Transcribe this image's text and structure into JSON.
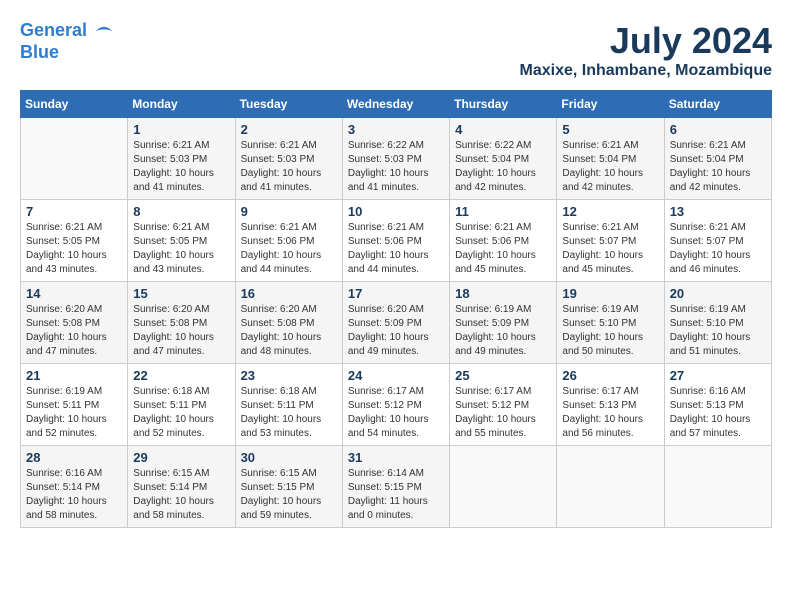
{
  "header": {
    "logo_line1": "General",
    "logo_line2": "Blue",
    "month_title": "July 2024",
    "location": "Maxixe, Inhambane, Mozambique"
  },
  "days_of_week": [
    "Sunday",
    "Monday",
    "Tuesday",
    "Wednesday",
    "Thursday",
    "Friday",
    "Saturday"
  ],
  "weeks": [
    [
      {
        "day": "",
        "info": ""
      },
      {
        "day": "1",
        "info": "Sunrise: 6:21 AM\nSunset: 5:03 PM\nDaylight: 10 hours\nand 41 minutes."
      },
      {
        "day": "2",
        "info": "Sunrise: 6:21 AM\nSunset: 5:03 PM\nDaylight: 10 hours\nand 41 minutes."
      },
      {
        "day": "3",
        "info": "Sunrise: 6:22 AM\nSunset: 5:03 PM\nDaylight: 10 hours\nand 41 minutes."
      },
      {
        "day": "4",
        "info": "Sunrise: 6:22 AM\nSunset: 5:04 PM\nDaylight: 10 hours\nand 42 minutes."
      },
      {
        "day": "5",
        "info": "Sunrise: 6:21 AM\nSunset: 5:04 PM\nDaylight: 10 hours\nand 42 minutes."
      },
      {
        "day": "6",
        "info": "Sunrise: 6:21 AM\nSunset: 5:04 PM\nDaylight: 10 hours\nand 42 minutes."
      }
    ],
    [
      {
        "day": "7",
        "info": "Sunrise: 6:21 AM\nSunset: 5:05 PM\nDaylight: 10 hours\nand 43 minutes."
      },
      {
        "day": "8",
        "info": "Sunrise: 6:21 AM\nSunset: 5:05 PM\nDaylight: 10 hours\nand 43 minutes."
      },
      {
        "day": "9",
        "info": "Sunrise: 6:21 AM\nSunset: 5:06 PM\nDaylight: 10 hours\nand 44 minutes."
      },
      {
        "day": "10",
        "info": "Sunrise: 6:21 AM\nSunset: 5:06 PM\nDaylight: 10 hours\nand 44 minutes."
      },
      {
        "day": "11",
        "info": "Sunrise: 6:21 AM\nSunset: 5:06 PM\nDaylight: 10 hours\nand 45 minutes."
      },
      {
        "day": "12",
        "info": "Sunrise: 6:21 AM\nSunset: 5:07 PM\nDaylight: 10 hours\nand 45 minutes."
      },
      {
        "day": "13",
        "info": "Sunrise: 6:21 AM\nSunset: 5:07 PM\nDaylight: 10 hours\nand 46 minutes."
      }
    ],
    [
      {
        "day": "14",
        "info": "Sunrise: 6:20 AM\nSunset: 5:08 PM\nDaylight: 10 hours\nand 47 minutes."
      },
      {
        "day": "15",
        "info": "Sunrise: 6:20 AM\nSunset: 5:08 PM\nDaylight: 10 hours\nand 47 minutes."
      },
      {
        "day": "16",
        "info": "Sunrise: 6:20 AM\nSunset: 5:08 PM\nDaylight: 10 hours\nand 48 minutes."
      },
      {
        "day": "17",
        "info": "Sunrise: 6:20 AM\nSunset: 5:09 PM\nDaylight: 10 hours\nand 49 minutes."
      },
      {
        "day": "18",
        "info": "Sunrise: 6:19 AM\nSunset: 5:09 PM\nDaylight: 10 hours\nand 49 minutes."
      },
      {
        "day": "19",
        "info": "Sunrise: 6:19 AM\nSunset: 5:10 PM\nDaylight: 10 hours\nand 50 minutes."
      },
      {
        "day": "20",
        "info": "Sunrise: 6:19 AM\nSunset: 5:10 PM\nDaylight: 10 hours\nand 51 minutes."
      }
    ],
    [
      {
        "day": "21",
        "info": "Sunrise: 6:19 AM\nSunset: 5:11 PM\nDaylight: 10 hours\nand 52 minutes."
      },
      {
        "day": "22",
        "info": "Sunrise: 6:18 AM\nSunset: 5:11 PM\nDaylight: 10 hours\nand 52 minutes."
      },
      {
        "day": "23",
        "info": "Sunrise: 6:18 AM\nSunset: 5:11 PM\nDaylight: 10 hours\nand 53 minutes."
      },
      {
        "day": "24",
        "info": "Sunrise: 6:17 AM\nSunset: 5:12 PM\nDaylight: 10 hours\nand 54 minutes."
      },
      {
        "day": "25",
        "info": "Sunrise: 6:17 AM\nSunset: 5:12 PM\nDaylight: 10 hours\nand 55 minutes."
      },
      {
        "day": "26",
        "info": "Sunrise: 6:17 AM\nSunset: 5:13 PM\nDaylight: 10 hours\nand 56 minutes."
      },
      {
        "day": "27",
        "info": "Sunrise: 6:16 AM\nSunset: 5:13 PM\nDaylight: 10 hours\nand 57 minutes."
      }
    ],
    [
      {
        "day": "28",
        "info": "Sunrise: 6:16 AM\nSunset: 5:14 PM\nDaylight: 10 hours\nand 58 minutes."
      },
      {
        "day": "29",
        "info": "Sunrise: 6:15 AM\nSunset: 5:14 PM\nDaylight: 10 hours\nand 58 minutes."
      },
      {
        "day": "30",
        "info": "Sunrise: 6:15 AM\nSunset: 5:15 PM\nDaylight: 10 hours\nand 59 minutes."
      },
      {
        "day": "31",
        "info": "Sunrise: 6:14 AM\nSunset: 5:15 PM\nDaylight: 11 hours\nand 0 minutes."
      },
      {
        "day": "",
        "info": ""
      },
      {
        "day": "",
        "info": ""
      },
      {
        "day": "",
        "info": ""
      }
    ]
  ]
}
